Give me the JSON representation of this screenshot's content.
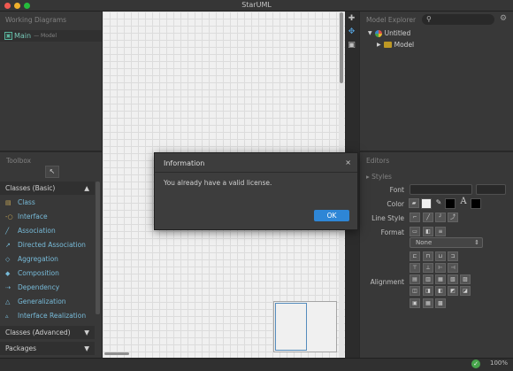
{
  "window": {
    "title": "StarUML"
  },
  "working_diagrams": {
    "header": "Working Diagrams",
    "item": {
      "label": "Main",
      "sub": "— Model"
    }
  },
  "toolbox": {
    "header": "Toolbox",
    "sections": [
      {
        "label": "Classes (Basic)",
        "arrow": "▲"
      },
      {
        "label": "Classes (Advanced)",
        "arrow": "▼"
      },
      {
        "label": "Packages",
        "arrow": "▼"
      }
    ],
    "tools": [
      "Class",
      "Interface",
      "Association",
      "Directed Association",
      "Aggregation",
      "Composition",
      "Dependency",
      "Generalization",
      "Interface Realization"
    ]
  },
  "model_explorer": {
    "header": "Model Explorer",
    "tree": [
      {
        "label": "Untitled"
      },
      {
        "label": "Model"
      }
    ]
  },
  "editors": {
    "header": "Editors",
    "styles_label": "Styles",
    "labels": {
      "font": "Font",
      "color": "Color",
      "line_style": "Line Style",
      "format": "Format",
      "alignment": "Alignment"
    },
    "format_select": "None"
  },
  "dialog": {
    "title": "Information",
    "close": "×",
    "message": "You already have a valid license.",
    "ok": "OK"
  },
  "status": {
    "zoom": "100%"
  },
  "colors": {
    "accent": "#2e86d6",
    "tree_link": "#7fc6e6",
    "ok": "#4caf50"
  }
}
